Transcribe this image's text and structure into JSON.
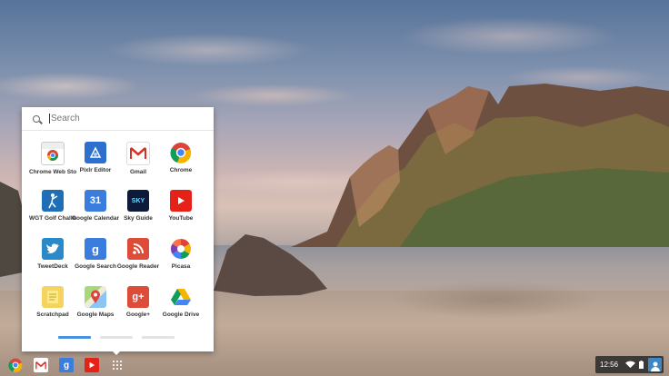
{
  "search": {
    "placeholder": "Search"
  },
  "apps": [
    {
      "name": "Chrome Web Store",
      "id": "chrome-web-store"
    },
    {
      "name": "Pixlr Editor",
      "id": "pixlr-editor"
    },
    {
      "name": "Gmail",
      "id": "gmail"
    },
    {
      "name": "Chrome",
      "id": "chrome"
    },
    {
      "name": "WGT Golf Challenge",
      "id": "wgt-golf"
    },
    {
      "name": "Google Calendar",
      "id": "google-calendar"
    },
    {
      "name": "Sky Guide",
      "id": "sky-guide"
    },
    {
      "name": "YouTube",
      "id": "youtube"
    },
    {
      "name": "TweetDeck",
      "id": "tweetdeck"
    },
    {
      "name": "Google Search",
      "id": "google-search"
    },
    {
      "name": "Google Reader",
      "id": "google-reader"
    },
    {
      "name": "Picasa",
      "id": "picasa"
    },
    {
      "name": "Scratchpad",
      "id": "scratchpad"
    },
    {
      "name": "Google Maps",
      "id": "google-maps"
    },
    {
      "name": "Google+",
      "id": "google-plus"
    },
    {
      "name": "Google Drive",
      "id": "google-drive"
    }
  ],
  "icon_text": {
    "calendar": "31",
    "search": "g",
    "gplus": "g+",
    "sky": "SKY"
  },
  "pager": {
    "pages": 3,
    "active": 0
  },
  "shelf": {
    "items": [
      "chrome-icon",
      "gmail-icon",
      "google-search-icon",
      "youtube-icon",
      "app-launcher-icon"
    ]
  },
  "tray": {
    "time": "12:56"
  },
  "colors": {
    "accent": "#4a90e2",
    "pager_inactive": "#e3e3e3"
  }
}
